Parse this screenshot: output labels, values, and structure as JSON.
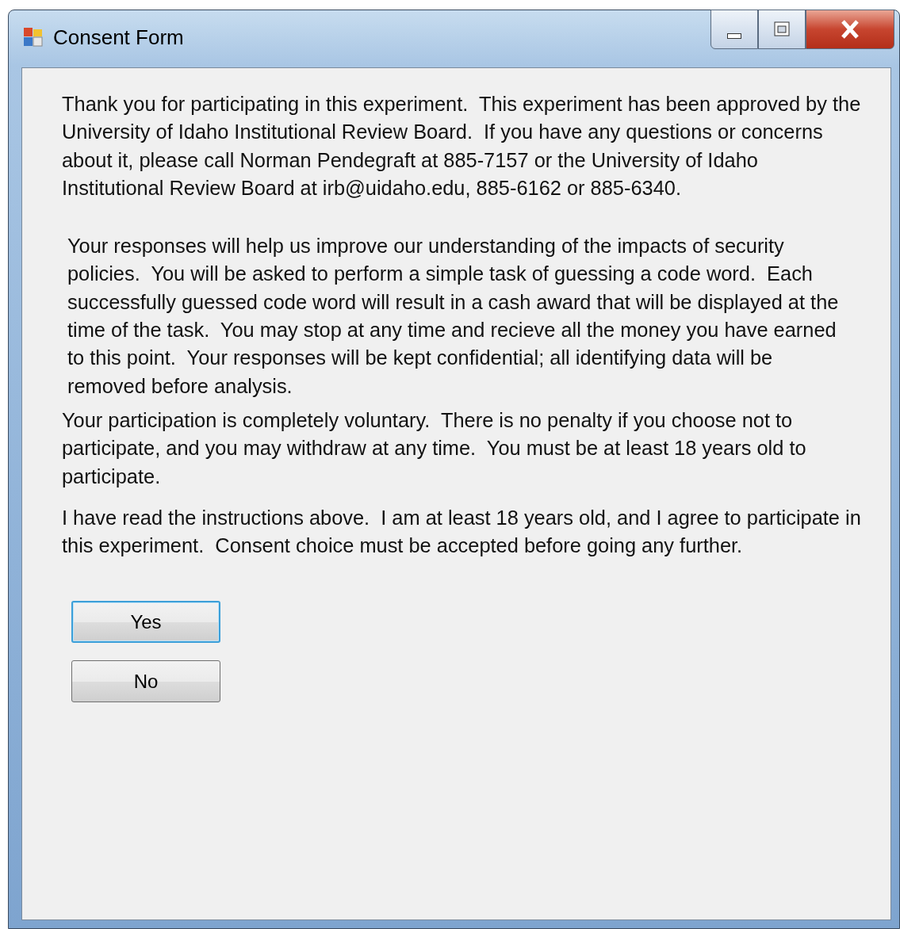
{
  "window": {
    "title": "Consent Form"
  },
  "paragraphs": [
    {
      "kind": "plain",
      "text": "Thank you for participating in this experiment.  This experiment has been approved by the University of Idaho Institutional Review Board.  If you have any questions or concerns about it, please call Norman Pendegraft at 885-7157 or the University of Idaho Institutional Review Board at irb@uidaho.edu, 885-6162 or 885-6340."
    },
    {
      "kind": "indented",
      "text": "Your responses will help us improve our understanding of the impacts of security policies.  You will be asked to perform a simple task of guessing a code word.  Each successfully guessed code word will result in a cash award that will be displayed at the time of the task.  You may stop at any time and recieve all the money you have earned to this point.  Your responses will be kept confidential; all identifying data will be removed before analysis."
    },
    {
      "kind": "plain",
      "text": "Your participation is completely voluntary.  There is no penalty if you choose not to participate, and you may withdraw at any time.  You must be at least 18 years old to participate."
    },
    {
      "kind": "plain",
      "text": "I have read the instructions above.  I am at least 18 years old, and I agree to participate in this experiment.  Consent choice must be accepted before going any further."
    }
  ],
  "buttons": [
    {
      "label": "Yes",
      "selected": true
    },
    {
      "label": "No",
      "selected": false
    }
  ]
}
